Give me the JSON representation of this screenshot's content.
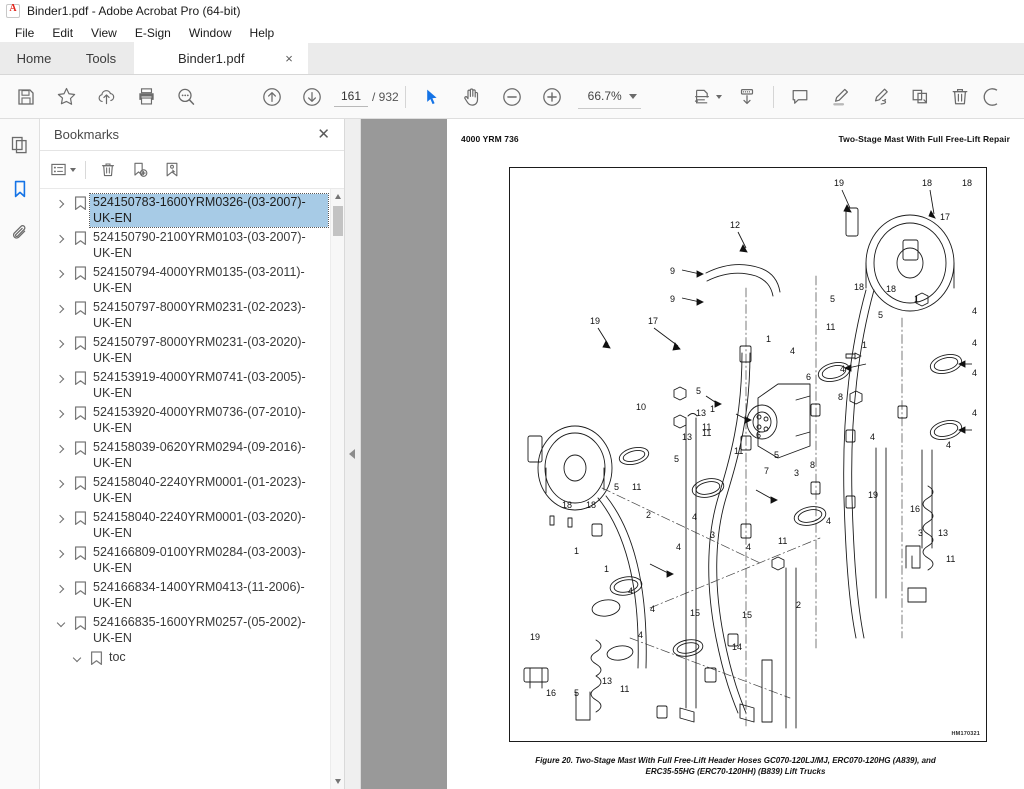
{
  "window": {
    "title": "Binder1.pdf - Adobe Acrobat Pro (64-bit)",
    "logo_icon": "acrobat-logo-icon"
  },
  "menubar": {
    "items": [
      {
        "label": "File"
      },
      {
        "label": "Edit"
      },
      {
        "label": "View"
      },
      {
        "label": "E-Sign"
      },
      {
        "label": "Window"
      },
      {
        "label": "Help"
      }
    ]
  },
  "tabs": {
    "home_label": "Home",
    "tools_label": "Tools",
    "document_label": "Binder1.pdf",
    "close_glyph": "×"
  },
  "toolbar": {
    "save_icon": "save-icon",
    "star_icon": "star-icon",
    "cloud_upload_icon": "cloud-upload-icon",
    "print_icon": "print-icon",
    "search_icon": "search-icon",
    "prev_page_icon": "arrow-up-circle-icon",
    "next_page_icon": "arrow-down-circle-icon",
    "select_icon": "select-cursor-icon",
    "hand_icon": "hand-tool-icon",
    "zoom_out_icon": "zoom-out-icon",
    "zoom_in_icon": "zoom-in-icon",
    "fit_page_icon": "fit-page-icon",
    "scroll_mode_icon": "scroll-mode-icon",
    "comment_icon": "comment-icon",
    "highlight_icon": "highlight-icon",
    "draw_icon": "draw-icon",
    "stamp_icon": "stamp-edit-icon",
    "delete_icon": "trash-icon",
    "more_icon": "more-tools-icon",
    "page_current": "161",
    "page_total": "/ 932",
    "zoom_value": "66.7%"
  },
  "rail": {
    "thumbnails_icon": "page-thumbnails-icon",
    "bookmarks_icon": "bookmarks-icon",
    "attachments_icon": "attachments-paperclip-icon"
  },
  "bookmarks_panel": {
    "title": "Bookmarks",
    "close_glyph": "✕",
    "options_icon": "list-options-icon",
    "delete_icon": "delete-bookmark-icon",
    "new_icon": "new-bookmark-icon",
    "edit_icon": "edit-bookmark-icon",
    "items": [
      {
        "label": "524150783-1600YRM0326-(03-2007)-UK-EN",
        "expanded": false,
        "selected": true,
        "child": false
      },
      {
        "label": "524150790-2100YRM0103-(03-2007)-UK-EN",
        "expanded": false,
        "selected": false,
        "child": false
      },
      {
        "label": "524150794-4000YRM0135-(03-2011)-UK-EN",
        "expanded": false,
        "selected": false,
        "child": false
      },
      {
        "label": "524150797-8000YRM0231-(02-2023)-UK-EN",
        "expanded": false,
        "selected": false,
        "child": false
      },
      {
        "label": "524150797-8000YRM0231-(03-2020)-UK-EN",
        "expanded": false,
        "selected": false,
        "child": false
      },
      {
        "label": "524153919-4000YRM0741-(03-2005)-UK-EN",
        "expanded": false,
        "selected": false,
        "child": false
      },
      {
        "label": "524153920-4000YRM0736-(07-2010)-UK-EN",
        "expanded": false,
        "selected": false,
        "child": false
      },
      {
        "label": "524158039-0620YRM0294-(09-2016)-UK-EN",
        "expanded": false,
        "selected": false,
        "child": false
      },
      {
        "label": "524158040-2240YRM0001-(01-2023)-UK-EN",
        "expanded": false,
        "selected": false,
        "child": false
      },
      {
        "label": "524158040-2240YRM0001-(03-2020)-UK-EN",
        "expanded": false,
        "selected": false,
        "child": false
      },
      {
        "label": "524166809-0100YRM0284-(03-2003)-UK-EN",
        "expanded": false,
        "selected": false,
        "child": false
      },
      {
        "label": "524166834-1400YRM0413-(11-2006)-UK-EN",
        "expanded": false,
        "selected": false,
        "child": false
      },
      {
        "label": "524166835-1600YRM0257-(05-2002)-UK-EN",
        "expanded": true,
        "selected": false,
        "child": false
      },
      {
        "label": "toc",
        "expanded": true,
        "selected": false,
        "child": true
      }
    ]
  },
  "splitter": {
    "collapse_icon": "collapse-panel-arrow-icon"
  },
  "document": {
    "header_left": "4000 YRM 736",
    "header_right": "Two-Stage Mast With Full Free-Lift Repair",
    "drawing_number": "HM170321",
    "figure_caption_line1": "Figure 20. Two-Stage Mast With Full Free-Lift Header Hoses GC070-120LJ/MJ, ERC070-120HG (A839), and",
    "figure_caption_line2": "ERC35-55HG (ERC70-120HH) (B839) Lift Trucks",
    "callouts": [
      "19",
      "17",
      "12",
      "9",
      "9",
      "18",
      "17",
      "19",
      "18",
      "5",
      "11",
      "1",
      "4",
      "4",
      "4",
      "4",
      "1",
      "16",
      "11",
      "10",
      "1",
      "13",
      "11",
      "5",
      "4",
      "4",
      "2",
      "5",
      "11",
      "18",
      "18",
      "2",
      "4",
      "3",
      "4",
      "11",
      "6",
      "5",
      "7",
      "3",
      "8",
      "4",
      "4",
      "4",
      "16",
      "3",
      "13",
      "11",
      "19",
      "15",
      "15",
      "14",
      "2",
      "4",
      "19",
      "16",
      "5",
      "13",
      "11"
    ]
  },
  "colors": {
    "accent_blue": "#1473e6",
    "selection_blue": "#a7cbe6",
    "viewer_gray": "#999999",
    "toolbar_gray": "#fafafa",
    "brand_red": "#e2231a"
  }
}
